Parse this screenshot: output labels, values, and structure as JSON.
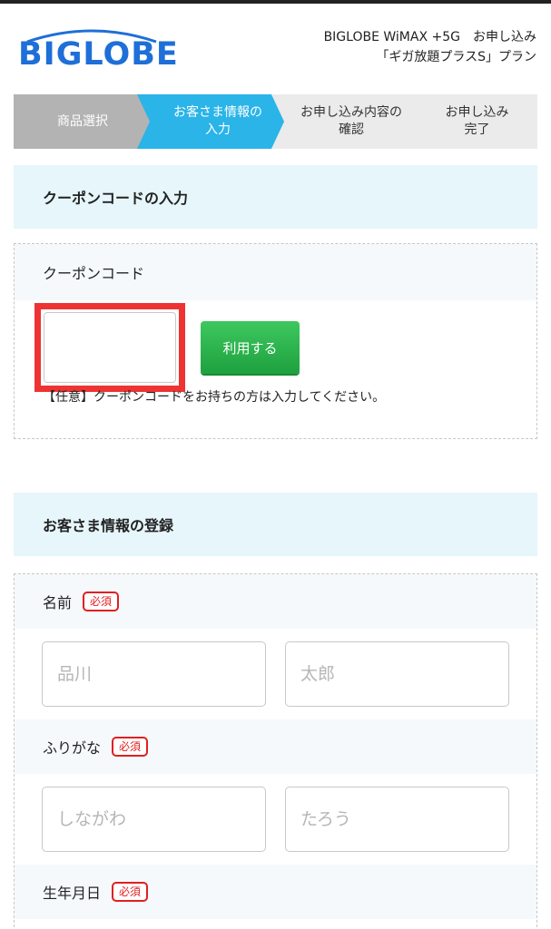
{
  "header": {
    "logo_text": "BIGLOBE",
    "plan_line1": "BIGLOBE WiMAX +5G　お申し込み",
    "plan_line2": "「ギガ放題プラスS」プラン"
  },
  "steps": [
    {
      "label": "商品選択",
      "state": "done"
    },
    {
      "label": "お客さま情報の\n入力",
      "state": "current"
    },
    {
      "label": "お申し込み内容の\n確認",
      "state": "upcoming"
    },
    {
      "label": "お申し込み\n完了",
      "state": "upcoming"
    }
  ],
  "coupon_section": {
    "heading": "クーポンコードの入力",
    "field_label": "クーポンコード",
    "input_value": "",
    "apply_button": "利用する",
    "note": "【任意】クーポンコードをお持ちの方は入力してください。"
  },
  "customer_section": {
    "heading": "お客さま情報の登録",
    "required_badge": "必須",
    "name": {
      "label": "名前",
      "last_placeholder": "品川",
      "first_placeholder": "太郎"
    },
    "furigana": {
      "label": "ふりがな",
      "last_placeholder": "しながわ",
      "first_placeholder": "たろう"
    },
    "birthdate": {
      "label": "生年月日"
    }
  },
  "colors": {
    "brand_blue": "#1e6fd8",
    "step_current": "#2ab4e8",
    "step_done": "#b3b3b3",
    "apply_green": "#22a846",
    "required_red": "#e02020",
    "highlight_red": "#ee3333"
  }
}
